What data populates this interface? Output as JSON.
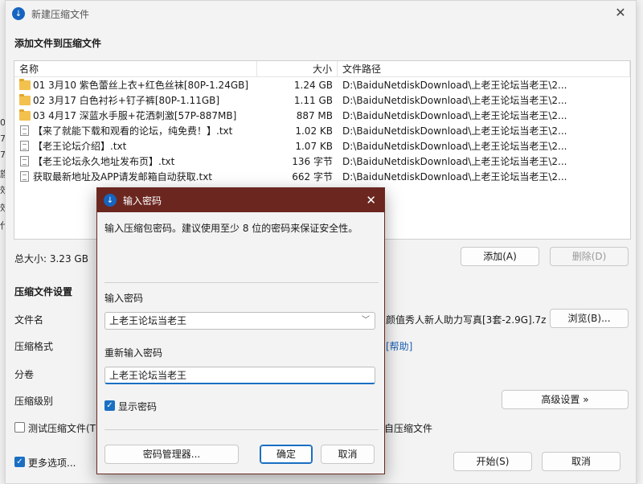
{
  "main_window": {
    "title": "新建压缩文件",
    "add_files_heading": "添加文件到压缩文件",
    "columns": {
      "name": "名称",
      "size": "大小",
      "path": "文件路径"
    },
    "files": [
      {
        "type": "folder",
        "name": "01 3月10 紫色蕾丝上衣+红色丝袜[80P-1.24GB]",
        "size": "1.24 GB",
        "path": "D:\\BaiduNetdiskDownload\\上老王论坛当老王\\2..."
      },
      {
        "type": "folder",
        "name": "02 3月17 白色衬衫+钉子裤[80P-1.11GB]",
        "size": "1.11 GB",
        "path": "D:\\BaiduNetdiskDownload\\上老王论坛当老王\\2..."
      },
      {
        "type": "folder",
        "name": "03 4月17 深蓝水手服+花洒刺激[57P-887MB]",
        "size": "887 MB",
        "path": "D:\\BaiduNetdiskDownload\\上老王论坛当老王\\2..."
      },
      {
        "type": "file",
        "name": "【来了就能下载和观看的论坛，纯免费！】.txt",
        "size": "1.02 KB",
        "path": "D:\\BaiduNetdiskDownload\\上老王论坛当老王\\2..."
      },
      {
        "type": "file",
        "name": "【老王论坛介绍】.txt",
        "size": "1.07 KB",
        "path": "D:\\BaiduNetdiskDownload\\上老王论坛当老王\\2..."
      },
      {
        "type": "file",
        "name": "【老王论坛永久地址发布页】.txt",
        "size": "136 字节",
        "path": "D:\\BaiduNetdiskDownload\\上老王论坛当老王\\2..."
      },
      {
        "type": "file",
        "name": "获取最新地址及APP请发邮箱自动获取.txt",
        "size": "662 字节",
        "path": "D:\\BaiduNetdiskDownload\\上老王论坛当老王\\2..."
      }
    ],
    "total_size": "总大小: 3.23 GB",
    "add_button": "添加(A)",
    "remove_button": "删除(D)",
    "settings_heading": "压缩文件设置",
    "filename_label": "文件名",
    "filename_value": "颜值秀人新人助力写真[3套-2.9G].7z",
    "browse_button": "浏览(B)...",
    "format_label": "压缩格式",
    "help_link": "[帮助]",
    "split_label": "分卷",
    "level_label": "压缩级别",
    "advanced_button": "高级设置 »",
    "test_label": "测试压缩文件(T)",
    "self_extract_partial": "自压缩文件",
    "more_options_label": "更多选项...",
    "start_button": "开始(S)",
    "cancel_button": "取消"
  },
  "password_dialog": {
    "title": "输入密码",
    "description": "输入压缩包密码。建议使用至少 8 位的密码来保证安全性。",
    "enter_label": "输入密码",
    "enter_value": "上老王论坛当老王",
    "reenter_label": "重新输入密码",
    "reenter_value": "上老王论坛当老王",
    "show_password_label": "显示密码",
    "manager_button": "密码管理器...",
    "ok_button": "确定",
    "cancel_button": "取消"
  },
  "background_edge": {
    "glyphs": [
      "0",
      "7",
      "7",
      "旗",
      "效",
      "效",
      "代"
    ]
  }
}
